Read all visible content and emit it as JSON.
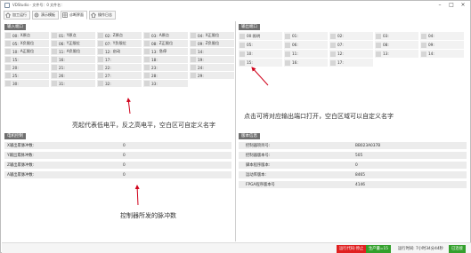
{
  "window": {
    "title": "VDStudio · 文件号：0  文件名："
  },
  "tabs": [
    {
      "label": "加工运行",
      "icon": "home-icon"
    },
    {
      "label": "演示模板",
      "icon": "gear-icon"
    },
    {
      "label": "诊断界面",
      "icon": "grid-icon"
    },
    {
      "label": "操作日志",
      "icon": "home-icon"
    }
  ],
  "input_panel": {
    "title": "输入端口",
    "items": [
      {
        "num": "00:",
        "name": "X原点"
      },
      {
        "num": "01:",
        "name": "Y原点"
      },
      {
        "num": "02:",
        "name": "Z原点"
      },
      {
        "num": "03:",
        "name": "A原点"
      },
      {
        "num": "04:",
        "name": "X正限位"
      },
      {
        "num": "05:",
        "name": "X负限位"
      },
      {
        "num": "06:",
        "name": "Y正限位"
      },
      {
        "num": "07:",
        "name": "Y负限位"
      },
      {
        "num": "08:",
        "name": "Z正限位"
      },
      {
        "num": "09:",
        "name": "Z负限位"
      },
      {
        "num": "10:",
        "name": "A正限位"
      },
      {
        "num": "11:",
        "name": "A负限位"
      },
      {
        "num": "12:",
        "name": "启动"
      },
      {
        "num": "13:",
        "name": "急停"
      },
      {
        "num": "14:",
        "name": ""
      },
      {
        "num": "15:",
        "name": ""
      },
      {
        "num": "16:",
        "name": ""
      },
      {
        "num": "17:",
        "name": ""
      },
      {
        "num": "18:",
        "name": ""
      },
      {
        "num": "19:",
        "name": ""
      },
      {
        "num": "20:",
        "name": ""
      },
      {
        "num": "21:",
        "name": ""
      },
      {
        "num": "22:",
        "name": ""
      },
      {
        "num": "23:",
        "name": ""
      },
      {
        "num": "24:",
        "name": ""
      },
      {
        "num": "25:",
        "name": ""
      },
      {
        "num": "26:",
        "name": ""
      },
      {
        "num": "27:",
        "name": ""
      },
      {
        "num": "28:",
        "name": ""
      },
      {
        "num": "29:",
        "name": ""
      },
      {
        "num": "30:",
        "name": ""
      },
      {
        "num": "31:",
        "name": ""
      },
      {
        "num": "32:",
        "name": ""
      },
      {
        "num": "33:",
        "name": ""
      }
    ],
    "note": "亮起代表低电平，反之高电平，空白区可自定义名字"
  },
  "output_panel": {
    "title": "输出端口",
    "items": [
      {
        "num": "00:",
        "name": "照明"
      },
      {
        "num": "01:",
        "name": ""
      },
      {
        "num": "02:",
        "name": ""
      },
      {
        "num": "03:",
        "name": ""
      },
      {
        "num": "04:",
        "name": ""
      },
      {
        "num": "05:",
        "name": ""
      },
      {
        "num": "06:",
        "name": ""
      },
      {
        "num": "07:",
        "name": ""
      },
      {
        "num": "08:",
        "name": ""
      },
      {
        "num": "09:",
        "name": ""
      },
      {
        "num": "10:",
        "name": ""
      },
      {
        "num": "11:",
        "name": ""
      },
      {
        "num": "12:",
        "name": ""
      },
      {
        "num": "13:",
        "name": ""
      },
      {
        "num": "14:",
        "name": ""
      },
      {
        "num": "15:",
        "name": ""
      },
      {
        "num": "16:",
        "name": ""
      },
      {
        "num": "17:",
        "name": ""
      }
    ],
    "note": "点击可将对应输出端口打开，空白区域可以自定义名字"
  },
  "pulse_panel": {
    "title": "电机控制",
    "rows": [
      {
        "label": "X输出累脉冲数:",
        "value": "0"
      },
      {
        "label": "Y输出累脉冲数:",
        "value": "0"
      },
      {
        "label": "Z输出累脉冲数:",
        "value": "0"
      },
      {
        "label": "A输出累脉冲数:",
        "value": "0"
      }
    ],
    "note": "控制器所发的脉冲数"
  },
  "version_panel": {
    "title": "版本信息",
    "rows": [
      {
        "label": "控制器项目号:",
        "value": "BB023A037B"
      },
      {
        "label": "控制器版本号:",
        "value": "505"
      },
      {
        "label": "脚本程序版本:",
        "value": "0"
      },
      {
        "label": "运动库版本:",
        "value": "8465"
      },
      {
        "label": "FPGA程序版本号",
        "value": "4146"
      }
    ]
  },
  "statusbar": {
    "alarm": "运行代码:停止",
    "count": "生产量=15",
    "runtime": "运行时间: 7小时34分44秒",
    "connection": "已连接"
  },
  "colors": {
    "header": "#6f6f6f",
    "arrow": "#d0021b",
    "alarm": "#e02020",
    "ok": "#33a02c"
  }
}
